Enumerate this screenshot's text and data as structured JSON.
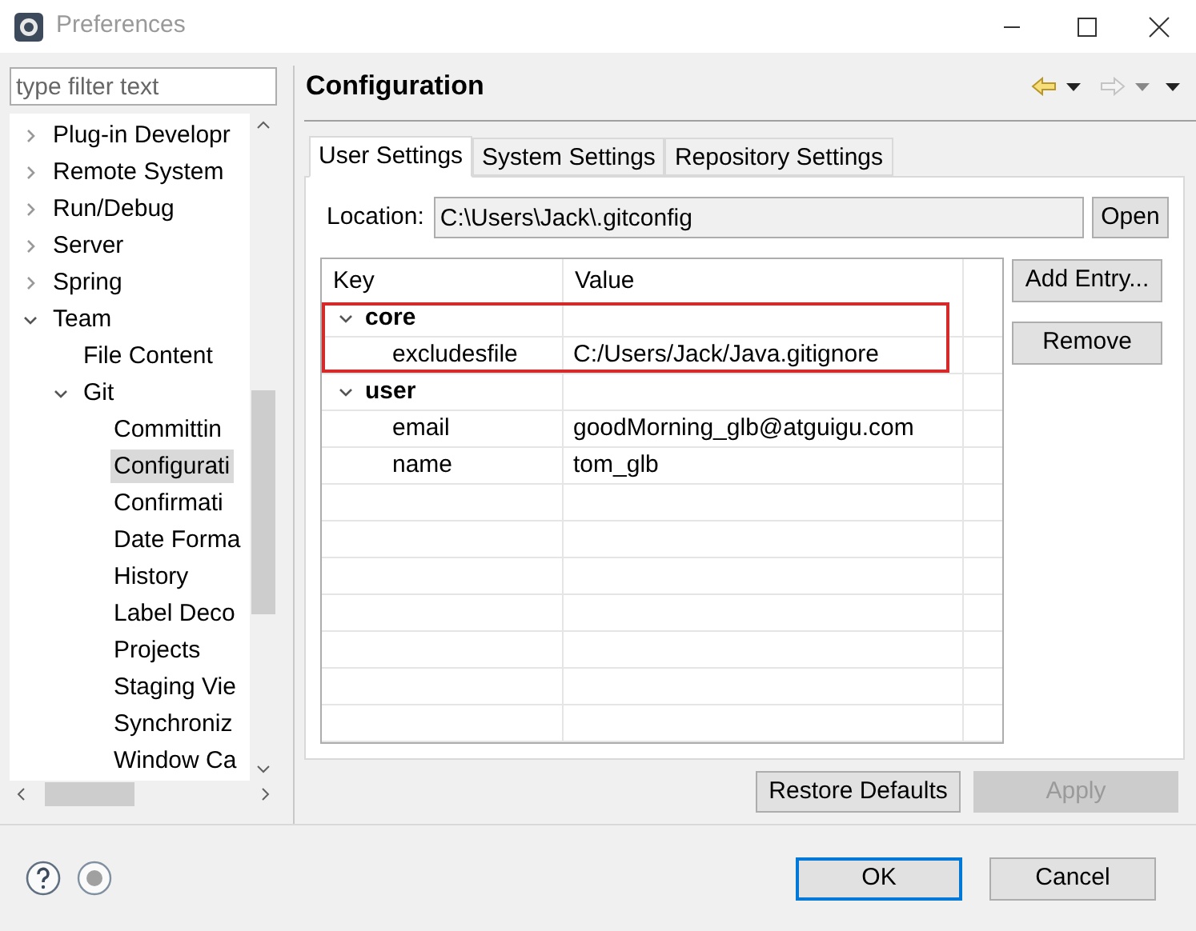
{
  "window": {
    "title": "Preferences"
  },
  "filter": {
    "placeholder": "type filter text"
  },
  "tree": [
    {
      "label": "Plug-in Developr",
      "expanded": false,
      "selected": false
    },
    {
      "label": "Remote System",
      "expanded": false,
      "selected": false
    },
    {
      "label": "Run/Debug",
      "expanded": false,
      "selected": false
    },
    {
      "label": "Server",
      "expanded": false,
      "selected": false
    },
    {
      "label": "Spring",
      "expanded": false,
      "selected": false
    },
    {
      "label": "Team",
      "expanded": true,
      "selected": false,
      "children": [
        {
          "label": "File Content",
          "selected": false
        },
        {
          "label": "Git",
          "expanded": true,
          "selected": false,
          "children": [
            {
              "label": "Committin",
              "selected": false
            },
            {
              "label": "Configurati",
              "selected": true
            },
            {
              "label": "Confirmati",
              "selected": false
            },
            {
              "label": "Date Forma",
              "selected": false
            },
            {
              "label": "History",
              "selected": false
            },
            {
              "label": "Label Deco",
              "selected": false
            },
            {
              "label": "Projects",
              "selected": false
            },
            {
              "label": "Staging Vie",
              "selected": false
            },
            {
              "label": "Synchroniz",
              "selected": false
            },
            {
              "label": "Window Ca",
              "selected": false
            }
          ]
        }
      ]
    }
  ],
  "page": {
    "title": "Configuration"
  },
  "tabs": [
    {
      "label": "User Settings",
      "selected": true
    },
    {
      "label": "System Settings",
      "selected": false
    },
    {
      "label": "Repository Settings",
      "selected": false
    }
  ],
  "location": {
    "label": "Location:",
    "value": "C:\\Users\\Jack\\.gitconfig",
    "button": "Open"
  },
  "table": {
    "columns": [
      "Key",
      "Value"
    ],
    "sections": [
      {
        "name": "core",
        "expanded": true,
        "highlighted": true,
        "entries": [
          {
            "key": "excludesfile",
            "value": "C:/Users/Jack/Java.gitignore"
          }
        ]
      },
      {
        "name": "user",
        "expanded": true,
        "highlighted": false,
        "entries": [
          {
            "key": "email",
            "value": "goodMorning_glb@atguigu.com"
          },
          {
            "key": "name",
            "value": "tom_glb"
          }
        ]
      }
    ]
  },
  "side_buttons": [
    {
      "label": "Add Entry..."
    },
    {
      "label": "Remove"
    }
  ],
  "page_buttons": [
    {
      "label": "Restore Defaults",
      "disabled": false
    },
    {
      "label": "Apply",
      "disabled": true
    }
  ],
  "dialog_buttons": [
    {
      "label": "OK",
      "default": true
    },
    {
      "label": "Cancel",
      "default": false
    }
  ]
}
